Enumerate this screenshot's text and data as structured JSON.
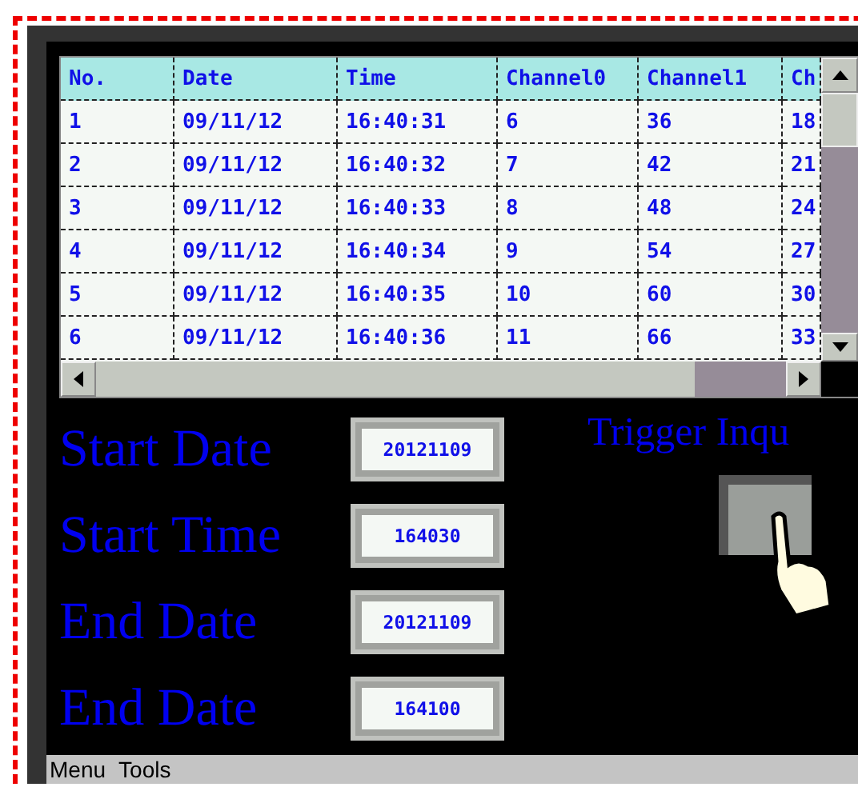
{
  "table": {
    "columns": [
      "No.",
      "Date",
      "Time",
      "Channel0",
      "Channel1",
      "Ch"
    ],
    "rows": [
      [
        "1",
        "09/11/12",
        "16:40:31",
        "6",
        "36",
        "18"
      ],
      [
        "2",
        "09/11/12",
        "16:40:32",
        "7",
        "42",
        "21"
      ],
      [
        "3",
        "09/11/12",
        "16:40:33",
        "8",
        "48",
        "24"
      ],
      [
        "4",
        "09/11/12",
        "16:40:34",
        "9",
        "54",
        "27"
      ],
      [
        "5",
        "09/11/12",
        "16:40:35",
        "10",
        "60",
        "30"
      ],
      [
        "6",
        "09/11/12",
        "16:40:36",
        "11",
        "66",
        "33"
      ]
    ]
  },
  "form": {
    "fields": [
      {
        "label": "Start Date",
        "value": "20121109"
      },
      {
        "label": "Start Time",
        "value": "164030"
      },
      {
        "label": "End Date",
        "value": "20121109"
      },
      {
        "label": "End Date",
        "value": "164100"
      }
    ]
  },
  "trigger": {
    "label": "Trigger Inqu"
  },
  "menu_bar": {
    "items": [
      "Menu",
      "Tools"
    ]
  }
}
